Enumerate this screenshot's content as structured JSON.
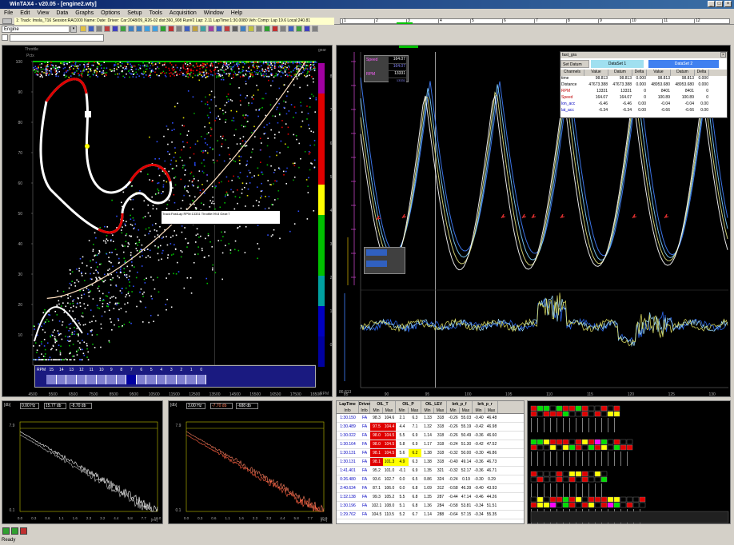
{
  "window": {
    "title": "WinTAX4 - v20.05 - [engine2.wty]"
  },
  "menu": [
    "File",
    "Edit",
    "View",
    "Data",
    "Graphs",
    "Options",
    "Setup",
    "Tools",
    "Acquisition",
    "Window",
    "Help"
  ],
  "infobar": {
    "text": "1: Track: Imola_T16  Session:RAC000  Name: Date:  Driver:  Car:2048/09_R26-02  dist:360_908  Run#2  Lap: 2.11  LapTime:1:30.0080  Veh: Comp: Lap 19.6  Local:240.81"
  },
  "timeline": {
    "ticks": [
      "1",
      "2",
      "3",
      "4",
      "5",
      "6",
      "7",
      "8",
      "9",
      "10",
      "11",
      "12"
    ]
  },
  "toolbar": {
    "combo_value": "Engine"
  },
  "scatter": {
    "y_label": "Throttle",
    "y_unit": "Pctx",
    "y_ticks": [
      "100",
      "90",
      "80",
      "70",
      "60",
      "50",
      "40",
      "30",
      "20",
      "10"
    ],
    "x_ticks": [
      "4500",
      "5500",
      "6500",
      "7500",
      "8500",
      "9500",
      "10500",
      "11500",
      "12500",
      "13500",
      "14500",
      "15500",
      "16500",
      "17500",
      "18500"
    ],
    "gear_label": "gear",
    "gear_ticks": [
      "8",
      "7",
      "6",
      "5",
      "4",
      "3",
      "2",
      "1",
      "0"
    ],
    "x_unit": "RPM",
    "tooltip": "Track:FastLap  RPM:13331  Throttle:99.8  Gear:7",
    "legend_label": "RPM",
    "legend_values": [
      "15",
      "14",
      "13",
      "12",
      "11",
      "10",
      "9",
      "8",
      "7",
      "6",
      "5",
      "4",
      "3",
      "2",
      "1",
      "0"
    ]
  },
  "overlay": {
    "speed_label": "Speed",
    "speed_values": [
      "164.07",
      "164.07"
    ],
    "rpm_label": "RPM",
    "rpm_values": [
      "13331",
      "13331"
    ],
    "x_ticks": [
      "85",
      "90",
      "95",
      "100",
      "105",
      "110",
      "115",
      "120",
      "125",
      "130"
    ],
    "x_start": "86:813",
    "left_ticks": [
      "2",
      "1",
      "0",
      "-1",
      "-2"
    ],
    "bottom_ticks": [
      "0.5",
      "0",
      "-0.5",
      "-1"
    ]
  },
  "popup": {
    "title": "fast_gra",
    "set_label": "Set Datum",
    "dataset1": "DataSet 1",
    "dataset2": "DataSet 2",
    "columns": [
      "Channels",
      "Value",
      "Datum",
      "Delta",
      "Value",
      "Datum",
      "Delta"
    ],
    "rows": [
      [
        "time",
        "98.813",
        "98.813",
        "0.000",
        "98.813",
        "98.813",
        "0.000"
      ],
      [
        "Distance",
        "47673.388",
        "47673.388",
        "0.000",
        "48953.680",
        "48953.680",
        "0.000"
      ],
      [
        "RPM",
        "13331",
        "13331",
        "0",
        "8401",
        "8401",
        "0"
      ],
      [
        "Speed",
        "164.07",
        "164.07",
        "0",
        "100.89",
        "100.89",
        "0"
      ],
      [
        "lon_acc",
        "-6.46",
        "-6.46",
        "0.00",
        "-0.04",
        "-0.04",
        "0.00"
      ],
      [
        "lat_acc",
        "-6.34",
        "-6.34",
        "0.00",
        "-0.66",
        "-0.66",
        "0.00"
      ]
    ],
    "row_colors": [
      "#000",
      "#000",
      "#c00000",
      "#c00000",
      "#0000c0",
      "#0000c0"
    ]
  },
  "spectrum1": {
    "unit": "[db]",
    "hz": "0.00 Hz",
    "db1": "15.77 db",
    "db2": "-8.70 db",
    "y_ticks": [
      "7.9",
      "0.1"
    ],
    "x_ticks": [
      "0.0",
      "0.3",
      "0.6",
      "1.1",
      "1.6",
      "2.3",
      "3.2",
      "4.4",
      "5.8",
      "7.7",
      "10.0"
    ],
    "x_unit": "[Hz]"
  },
  "spectrum2": {
    "unit": "[db]",
    "hz": "3.00 Hz",
    "db1": "-7.70 db",
    "db2": "-688 db",
    "y_ticks": [
      "7.9",
      "0.1"
    ],
    "x_ticks": [
      "0.0",
      "0.3",
      "0.6",
      "1.1",
      "1.6",
      "2.3",
      "3.2",
      "4.4",
      "5.8",
      "7.7",
      "10.0"
    ],
    "x_unit": "[Hz]"
  },
  "laptable": {
    "headers": [
      "LapTime",
      "Driver",
      "OIL_T",
      "OIL_P",
      "OIL_LEV",
      "brk_p_f",
      "brk_p_r"
    ],
    "sub": [
      "Info",
      "Info",
      "Min",
      "Max",
      "Min",
      "Max",
      "Min",
      "Max",
      "Min",
      "Max",
      "Min",
      "Max"
    ],
    "rows": [
      [
        "1:30.150",
        "FA",
        "98.3",
        "104.6",
        "2.1",
        "6.3",
        "1.33",
        "318",
        "-0.26",
        "55.03",
        "-0.40",
        "46.48"
      ],
      [
        "1:30.489",
        "FA",
        "97.5",
        "104.4",
        "4.4",
        "7.1",
        "1.32",
        "318",
        "-0.26",
        "55.19",
        "-0.42",
        "46.98"
      ],
      [
        "1:30.022",
        "FA",
        "98.0",
        "104.5",
        "5.5",
        "6.9",
        "1.14",
        "318",
        "-0.26",
        "50.49",
        "-0.36",
        "46.60"
      ],
      [
        "1:30.164",
        "FA",
        "98.0",
        "104.5",
        "5.8",
        "6.9",
        "1.17",
        "318",
        "-0.24",
        "51.30",
        "-0.42",
        "47.52"
      ],
      [
        "1:30.131",
        "FA",
        "98.1",
        "104.5",
        "5.6",
        "6.2",
        "1.38",
        "318",
        "-0.32",
        "50.00",
        "-0.30",
        "46.86"
      ],
      [
        "1:30.131",
        "FA",
        "98.1",
        "101.3",
        "4.9",
        "6.3",
        "1.38",
        "318",
        "-0.40",
        "49.14",
        "-0.36",
        "46.73"
      ],
      [
        "1:41.401",
        "FA",
        "95.2",
        "101.0",
        "-0.1",
        "6.9",
        "1.35",
        "321",
        "-0.32",
        "52.17",
        "-0.36",
        "46.71"
      ],
      [
        "0:26.480",
        "FA",
        "93.6",
        "102.7",
        "0.0",
        "6.5",
        "0.86",
        "324",
        "-0.24",
        "0.19",
        "-0.30",
        "0.29"
      ],
      [
        "2:40.634",
        "FA",
        "87.1",
        "106.0",
        "0.0",
        "6.8",
        "1.09",
        "312",
        "-0.58",
        "46.39",
        "-0.40",
        "43.93"
      ],
      [
        "1:32.138",
        "FA",
        "99.3",
        "105.2",
        "5.5",
        "6.8",
        "1.35",
        "287",
        "-0.44",
        "47.14",
        "-0.46",
        "44.26"
      ],
      [
        "1:30.196",
        "FA",
        "102.1",
        "108.0",
        "5.1",
        "6.8",
        "1.36",
        "284",
        "-0.58",
        "53.81",
        "-0.34",
        "51.51"
      ],
      [
        "1:29.762",
        "FA",
        "104.5",
        "110.5",
        "5.2",
        "6.7",
        "1.14",
        "288",
        "-0.64",
        "57.15",
        "-0.34",
        "55.35"
      ]
    ]
  },
  "statusbar": {
    "text": "Ready"
  },
  "colors": {
    "accent": "#0a246a",
    "green": "#00c000",
    "red": "#e00000",
    "yellow": "#ffff00",
    "blue": "#3060ff"
  }
}
